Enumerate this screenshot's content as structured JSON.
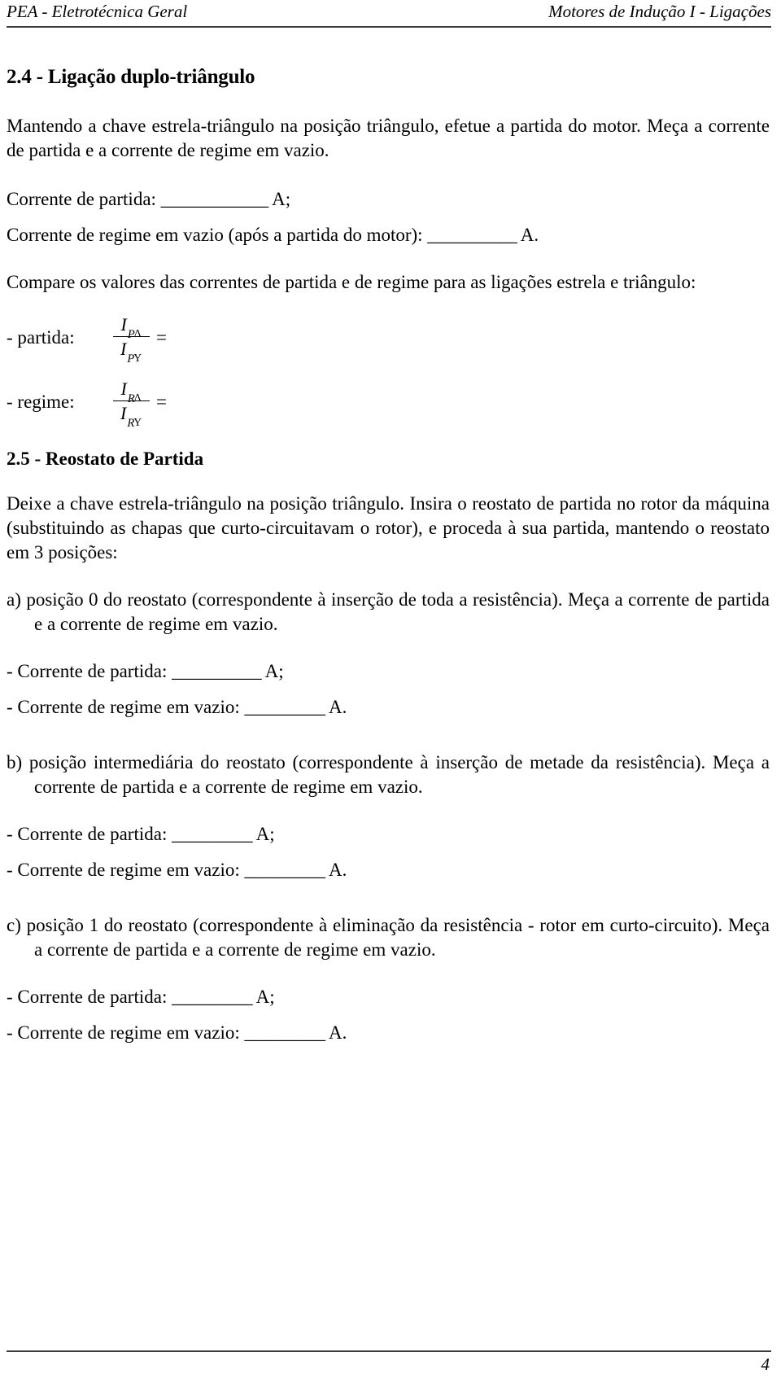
{
  "header": {
    "left": "PEA - Eletrotécnica Geral",
    "right": "Motores de Indução I - Ligações"
  },
  "sections": {
    "s24": {
      "title": "2.4 - Ligação duplo-triângulo",
      "intro": "Mantendo a chave estrela-triângulo na posição triângulo, efetue a partida do motor. Meça a corrente de partida e a corrente de regime em vazio.",
      "field_partida_label": "Corrente de partida:",
      "field_partida_blank": "____________",
      "field_partida_unit": "A;",
      "field_regime_label": "Corrente de regime em vazio (após a partida do motor):",
      "field_regime_blank": "__________",
      "field_regime_unit": "A.",
      "compare": "Compare os valores das correntes de partida e de regime para as ligações estrela e triângulo:",
      "ratio_partida_label": "-   partida:",
      "ratio_regime_label": "-   regime:",
      "ratio_partida": {
        "num_symbol": "I",
        "num_sub": "P",
        "num_sub2": "Δ",
        "den_symbol": "I",
        "den_sub": "P",
        "den_sub2": "Y",
        "equals": "="
      },
      "ratio_regime": {
        "num_symbol": "I",
        "num_sub": "R",
        "num_sub2": "Δ",
        "den_symbol": "I",
        "den_sub": "R",
        "den_sub2": "Y",
        "equals": "="
      }
    },
    "s25": {
      "title": "2.5 - Reostato de Partida",
      "intro": "Deixe a chave estrela-triângulo na posição triângulo. Insira o reostato de partida no rotor da máquina (substituindo as chapas que curto-circuitavam o rotor), e proceda à sua partida, mantendo o reostato em 3 posições:",
      "items": [
        {
          "text": "a) posição 0 do reostato (correspondente à inserção de toda a resistência). Meça a corrente de partida e a corrente de regime em vazio.",
          "partida_label": "- Corrente de partida:",
          "partida_blank": "__________",
          "partida_unit": "A;",
          "regime_label": "- Corrente de regime em vazio:",
          "regime_blank": "_________",
          "regime_unit": "A."
        },
        {
          "text": "b) posição intermediária do reostato (correspondente à inserção de metade da resistência). Meça a corrente de partida e a corrente de regime em vazio.",
          "partida_label": "- Corrente de partida:",
          "partida_blank": "_________",
          "partida_unit": "A;",
          "regime_label": "- Corrente de regime em vazio:",
          "regime_blank": "_________",
          "regime_unit": "A."
        },
        {
          "text": "c) posição 1 do reostato (correspondente à eliminação da resistência - rotor em curto-circuito). Meça a corrente de partida e a corrente de regime em vazio.",
          "partida_label": "- Corrente de partida:",
          "partida_blank": "_________",
          "partida_unit": "A;",
          "regime_label": "- Corrente de regime em vazio:",
          "regime_blank": "_________",
          "regime_unit": "A."
        }
      ]
    }
  },
  "footer": {
    "page_number": "4"
  }
}
